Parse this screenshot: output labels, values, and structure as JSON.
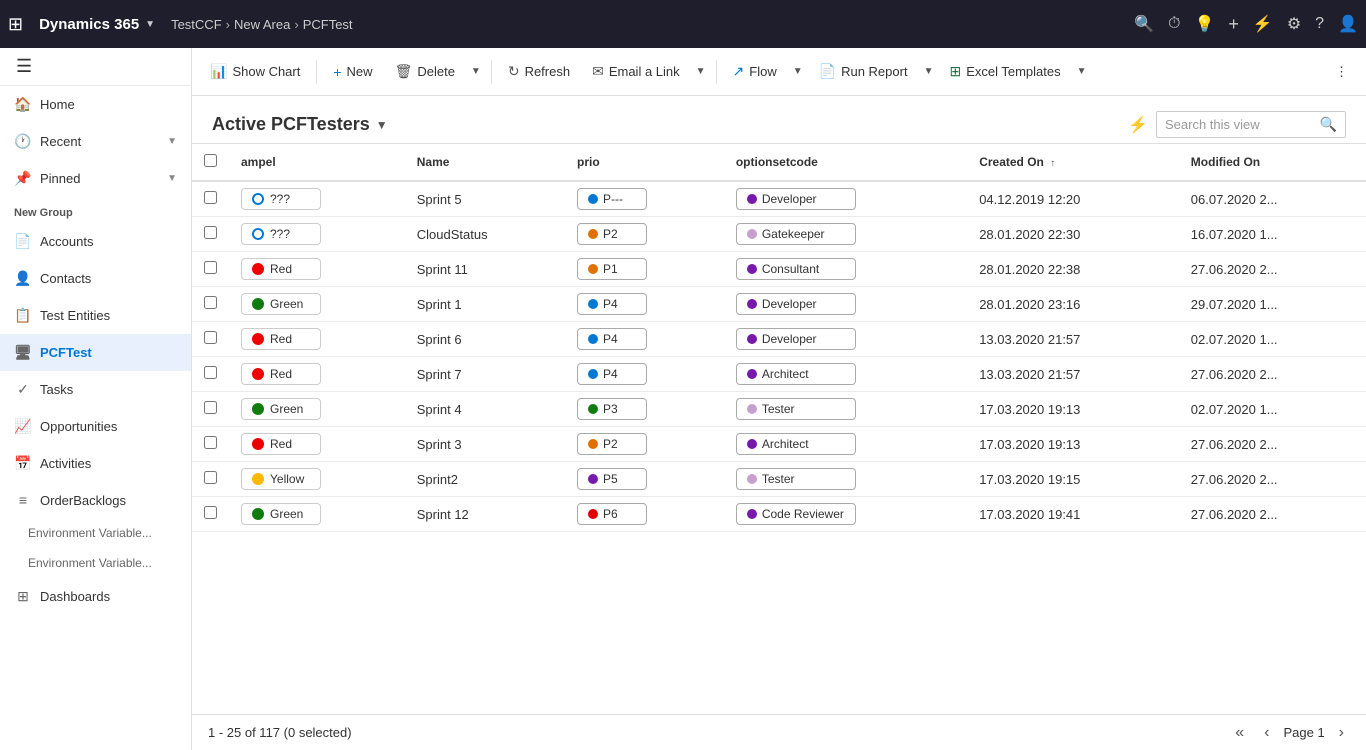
{
  "app": {
    "waffle": "⊞",
    "brand": "Dynamics 365",
    "env": "TestCCF",
    "area": "New Area",
    "page": "PCFTest",
    "icons": [
      "🔍",
      "⏰",
      "💡",
      "+",
      "⚡",
      "⚙",
      "?",
      "👤"
    ]
  },
  "toolbar": {
    "show_chart": "Show Chart",
    "new": "New",
    "delete": "Delete",
    "refresh": "Refresh",
    "email_link": "Email a Link",
    "flow": "Flow",
    "run_report": "Run Report",
    "excel_templates": "Excel Templates",
    "more": "⋮"
  },
  "view": {
    "title": "Active PCFTesters",
    "search_placeholder": "Search this view"
  },
  "columns": {
    "ampel": "ampel",
    "name": "Name",
    "prio": "prio",
    "optionsetcode": "optionsetcode",
    "created_on": "Created On",
    "modified_on": "Modified On"
  },
  "rows": [
    {
      "ampel_color": "dot-outline-blue",
      "ampel_label": "???",
      "name": "Sprint 5",
      "prio_color": "prio-blue",
      "prio_label": "P---",
      "opt_color": "opt-purple",
      "opt_label": "Developer",
      "created": "04.12.2019 12:20",
      "modified": "06.07.2020 2..."
    },
    {
      "ampel_color": "dot-outline-blue",
      "ampel_label": "???",
      "name": "CloudStatus",
      "prio_color": "prio-orange",
      "prio_label": "P2",
      "opt_color": "opt-light-purple",
      "opt_label": "Gatekeeper",
      "created": "28.01.2020 22:30",
      "modified": "16.07.2020 1..."
    },
    {
      "ampel_color": "dot-red",
      "ampel_label": "Red",
      "name": "Sprint 11",
      "prio_color": "prio-orange",
      "prio_label": "P1",
      "opt_color": "opt-purple",
      "opt_label": "Consultant",
      "created": "28.01.2020 22:38",
      "modified": "27.06.2020 2..."
    },
    {
      "ampel_color": "dot-green",
      "ampel_label": "Green",
      "name": "Sprint 1",
      "prio_color": "prio-blue",
      "prio_label": "P4",
      "opt_color": "opt-purple",
      "opt_label": "Developer",
      "created": "28.01.2020 23:16",
      "modified": "29.07.2020 1..."
    },
    {
      "ampel_color": "dot-red",
      "ampel_label": "Red",
      "name": "Sprint 6",
      "prio_color": "prio-blue",
      "prio_label": "P4",
      "opt_color": "opt-purple",
      "opt_label": "Developer",
      "created": "13.03.2020 21:57",
      "modified": "02.07.2020 1..."
    },
    {
      "ampel_color": "dot-red",
      "ampel_label": "Red",
      "name": "Sprint 7",
      "prio_color": "prio-blue",
      "prio_label": "P4",
      "opt_color": "opt-purple",
      "opt_label": "Architect",
      "created": "13.03.2020 21:57",
      "modified": "27.06.2020 2..."
    },
    {
      "ampel_color": "dot-green",
      "ampel_label": "Green",
      "name": "Sprint 4",
      "prio_color": "prio-green",
      "prio_label": "P3",
      "opt_color": "opt-light-purple",
      "opt_label": "Tester",
      "created": "17.03.2020 19:13",
      "modified": "02.07.2020 1..."
    },
    {
      "ampel_color": "dot-red",
      "ampel_label": "Red",
      "name": "Sprint 3",
      "prio_color": "prio-orange",
      "prio_label": "P2",
      "opt_color": "opt-purple",
      "opt_label": "Architect",
      "created": "17.03.2020 19:13",
      "modified": "27.06.2020 2..."
    },
    {
      "ampel_color": "dot-yellow",
      "ampel_label": "Yellow",
      "name": "Sprint2",
      "prio_color": "prio-purple",
      "prio_label": "P5",
      "opt_color": "opt-light-purple",
      "opt_label": "Tester",
      "created": "17.03.2020 19:15",
      "modified": "27.06.2020 2..."
    },
    {
      "ampel_color": "dot-green",
      "ampel_label": "Green",
      "name": "Sprint 12",
      "prio_color": "prio-red",
      "prio_label": "P6",
      "opt_color": "opt-purple",
      "opt_label": "Code Reviewer",
      "created": "17.03.2020 19:41",
      "modified": "27.06.2020 2..."
    }
  ],
  "status": {
    "record_info": "1 - 25 of 117 (0 selected)",
    "page_label": "Page 1"
  },
  "sidebar": {
    "hamburger": "☰",
    "home": "Home",
    "recent": "Recent",
    "pinned": "Pinned",
    "new_group": "New Group",
    "accounts": "Accounts",
    "contacts": "Contacts",
    "test_entities": "Test Entities",
    "pcftest": "PCFTest",
    "tasks": "Tasks",
    "opportunities": "Opportunities",
    "activities": "Activities",
    "order_backlogs": "OrderBacklogs",
    "env_var1": "Environment Variable...",
    "env_var2": "Environment Variable...",
    "dashboards": "Dashboards"
  }
}
